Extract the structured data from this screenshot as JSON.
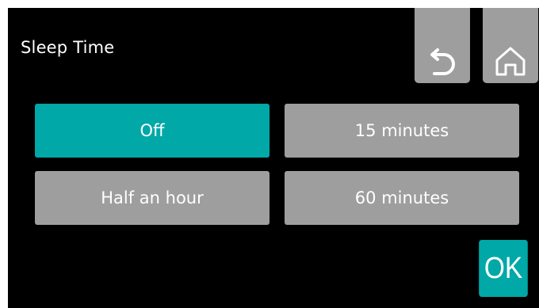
{
  "header": {
    "title": "Sleep Time",
    "back_icon": "undo-arrow-icon",
    "home_icon": "home-icon"
  },
  "options": [
    {
      "label": "Off",
      "selected": true
    },
    {
      "label": "15 minutes",
      "selected": false
    },
    {
      "label": "Half an hour",
      "selected": false
    },
    {
      "label": "60 minutes",
      "selected": false
    }
  ],
  "actions": {
    "ok_label": "OK"
  },
  "colors": {
    "background": "#000000",
    "button": "#9e9e9e",
    "accent": "#00a8a8",
    "text": "#ffffff"
  }
}
